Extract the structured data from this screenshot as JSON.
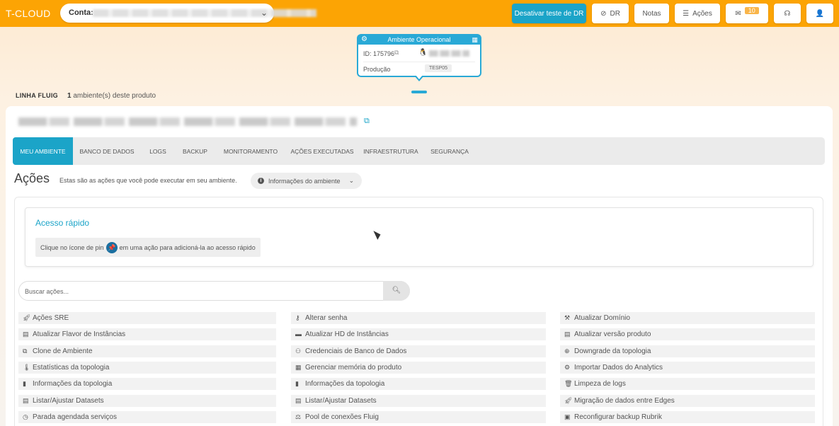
{
  "topbar": {
    "logo": "T-CLOUD",
    "account_label": "Conta:",
    "account_value": "",
    "buttons": {
      "dr_test": "Desativar teste de DR",
      "dr": "DR",
      "notes": "Notas",
      "actions": "Ações",
      "messages_badge": "10"
    }
  },
  "env_card": {
    "title": "Ambiente Operacional",
    "id_label": "ID: 175796",
    "type": "Produção",
    "tag": "TESP05"
  },
  "line": {
    "name": "LINHA FLUIG",
    "count_number": "1",
    "count_text": "ambiente(s) deste produto"
  },
  "tabs": [
    "MEU AMBIENTE",
    "BANCO DE DADOS",
    "LOGS",
    "BACKUP",
    "MONITORAMENTO",
    "AÇÕES EXECUTADAS",
    "INFRAESTRUTURA",
    "SEGURANÇA"
  ],
  "actions": {
    "title": "Ações",
    "subtitle": "Estas são as ações que você pode executar em seu ambiente.",
    "info_button": "Informações do ambiente",
    "quick_title": "Acesso rápido",
    "quick_hint_before": "Clique no ícone de pin",
    "quick_hint_after": "em uma ação para adicioná-la ao acesso rápido",
    "search_placeholder": "Buscar ações...",
    "columns": [
      [
        {
          "icon": "rocket-icon",
          "label": "Ações SRE"
        },
        {
          "icon": "server-icon",
          "label": "Atualizar Flavor de Instâncias"
        },
        {
          "icon": "clone-icon",
          "label": "Clone de Ambiente"
        },
        {
          "icon": "thermometer-icon",
          "label": "Estatísticas da topologia"
        },
        {
          "icon": "book-icon",
          "label": "Informações da topologia"
        },
        {
          "icon": "list-icon",
          "label": "Listar/Ajustar Datasets"
        },
        {
          "icon": "clock-icon",
          "label": "Parada agendada serviços"
        }
      ],
      [
        {
          "icon": "key-icon",
          "label": "Alterar senha"
        },
        {
          "icon": "hdd-icon",
          "label": "Atualizar HD de Instâncias"
        },
        {
          "icon": "users-icon",
          "label": "Credenciais de Banco de Dados"
        },
        {
          "icon": "memory-icon",
          "label": "Gerenciar memória do produto"
        },
        {
          "icon": "book-icon",
          "label": "Informações da topologia"
        },
        {
          "icon": "list-icon",
          "label": "Listar/Ajustar Datasets"
        },
        {
          "icon": "network-icon",
          "label": "Pool de conexões Fluig"
        }
      ],
      [
        {
          "icon": "wrench-icon",
          "label": "Atualizar Domínio"
        },
        {
          "icon": "server-icon",
          "label": "Atualizar versão produto"
        },
        {
          "icon": "circle-down-icon",
          "label": "Downgrade da topologia"
        },
        {
          "icon": "gears-icon",
          "label": "Importar Dados do Analytics"
        },
        {
          "icon": "trash-icon",
          "label": "Limpeza de logs"
        },
        {
          "icon": "rocket-icon",
          "label": "Migração de dados entre Edges"
        },
        {
          "icon": "save-icon",
          "label": "Reconfigurar backup Rubrik"
        }
      ]
    ]
  }
}
